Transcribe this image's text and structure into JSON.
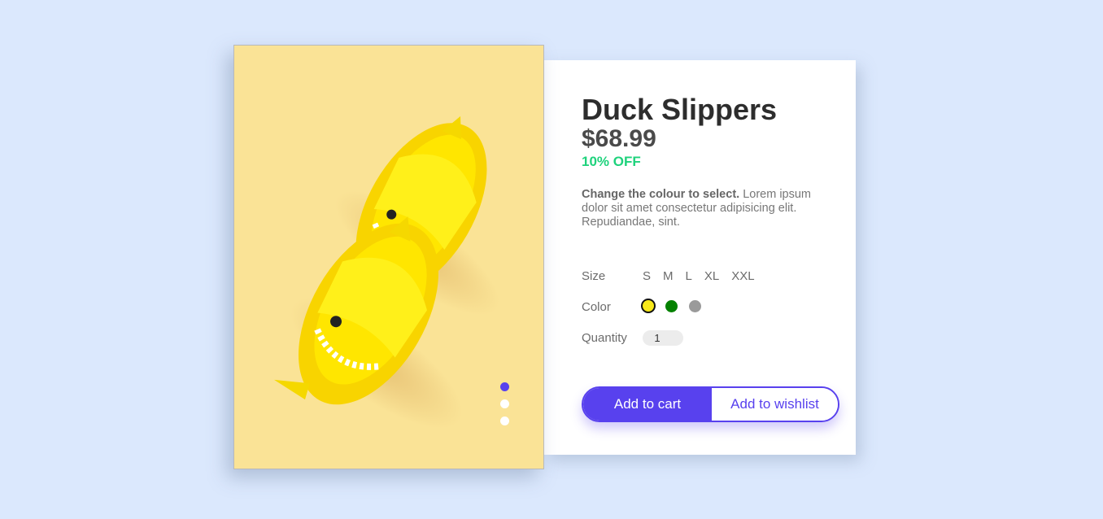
{
  "product": {
    "title": "Duck Slippers",
    "price": "$68.99",
    "discount": "10% OFF",
    "description_bold": "Change the colour to select.",
    "description_rest": " Lorem ipsum dolor sit amet consectetur adipisicing elit. Repudiandae, sint."
  },
  "options": {
    "size_label": "Size",
    "sizes": [
      "S",
      "M",
      "L",
      "XL",
      "XXL"
    ],
    "color_label": "Color",
    "colors": [
      {
        "name": "yellow",
        "hex": "#f7e81a",
        "selected": true
      },
      {
        "name": "green",
        "hex": "#048100",
        "selected": false
      },
      {
        "name": "gray",
        "hex": "#9a9a9a",
        "selected": false
      }
    ],
    "quantity_label": "Quantity",
    "quantity_value": "1"
  },
  "actions": {
    "add_to_cart": "Add to cart",
    "add_to_wishlist": "Add to wishlist"
  },
  "gallery": {
    "slide_count": 3,
    "active_slide": 0,
    "image_icon": "yellow-slippers-image",
    "accent": "#5841ee"
  }
}
